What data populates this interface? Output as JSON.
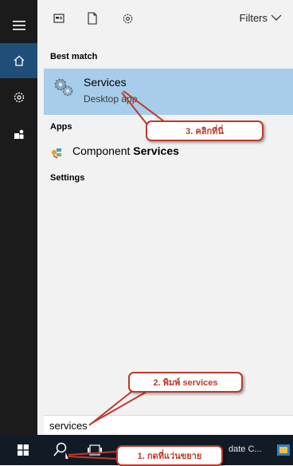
{
  "top_bar": {
    "filters_label": "Filters"
  },
  "sections": {
    "best_match": "Best match",
    "apps": "Apps",
    "settings": "Settings"
  },
  "best_match_item": {
    "title": "Services",
    "subtitle": "Desktop app"
  },
  "apps_item": {
    "label_prefix": "Component ",
    "label_bold": "Services"
  },
  "search": {
    "query": "services"
  },
  "taskbar": {
    "app_label": "date C..."
  },
  "callouts": {
    "step1": "1. กดที่แว่นขยาย",
    "step2": "2. พิมพ์ services",
    "step3": "3. คลิกที่นี่"
  },
  "icons": {
    "rail": [
      "hamburger-icon",
      "home-icon",
      "gear-icon",
      "user-icon"
    ],
    "top": [
      "documents-icon",
      "document-icon",
      "settings-icon",
      "chevron-down-icon"
    ],
    "taskbar": [
      "windows-start-icon",
      "search-icon",
      "task-view-icon",
      "app-icon"
    ]
  },
  "colors": {
    "rail_bg": "#1b1b1b",
    "rail_active": "#1f4e79",
    "panel_bg": "#f2f2f2",
    "highlight": "#a8cdea",
    "taskbar_bg": "#101b26",
    "callout_red": "#c0392b"
  }
}
